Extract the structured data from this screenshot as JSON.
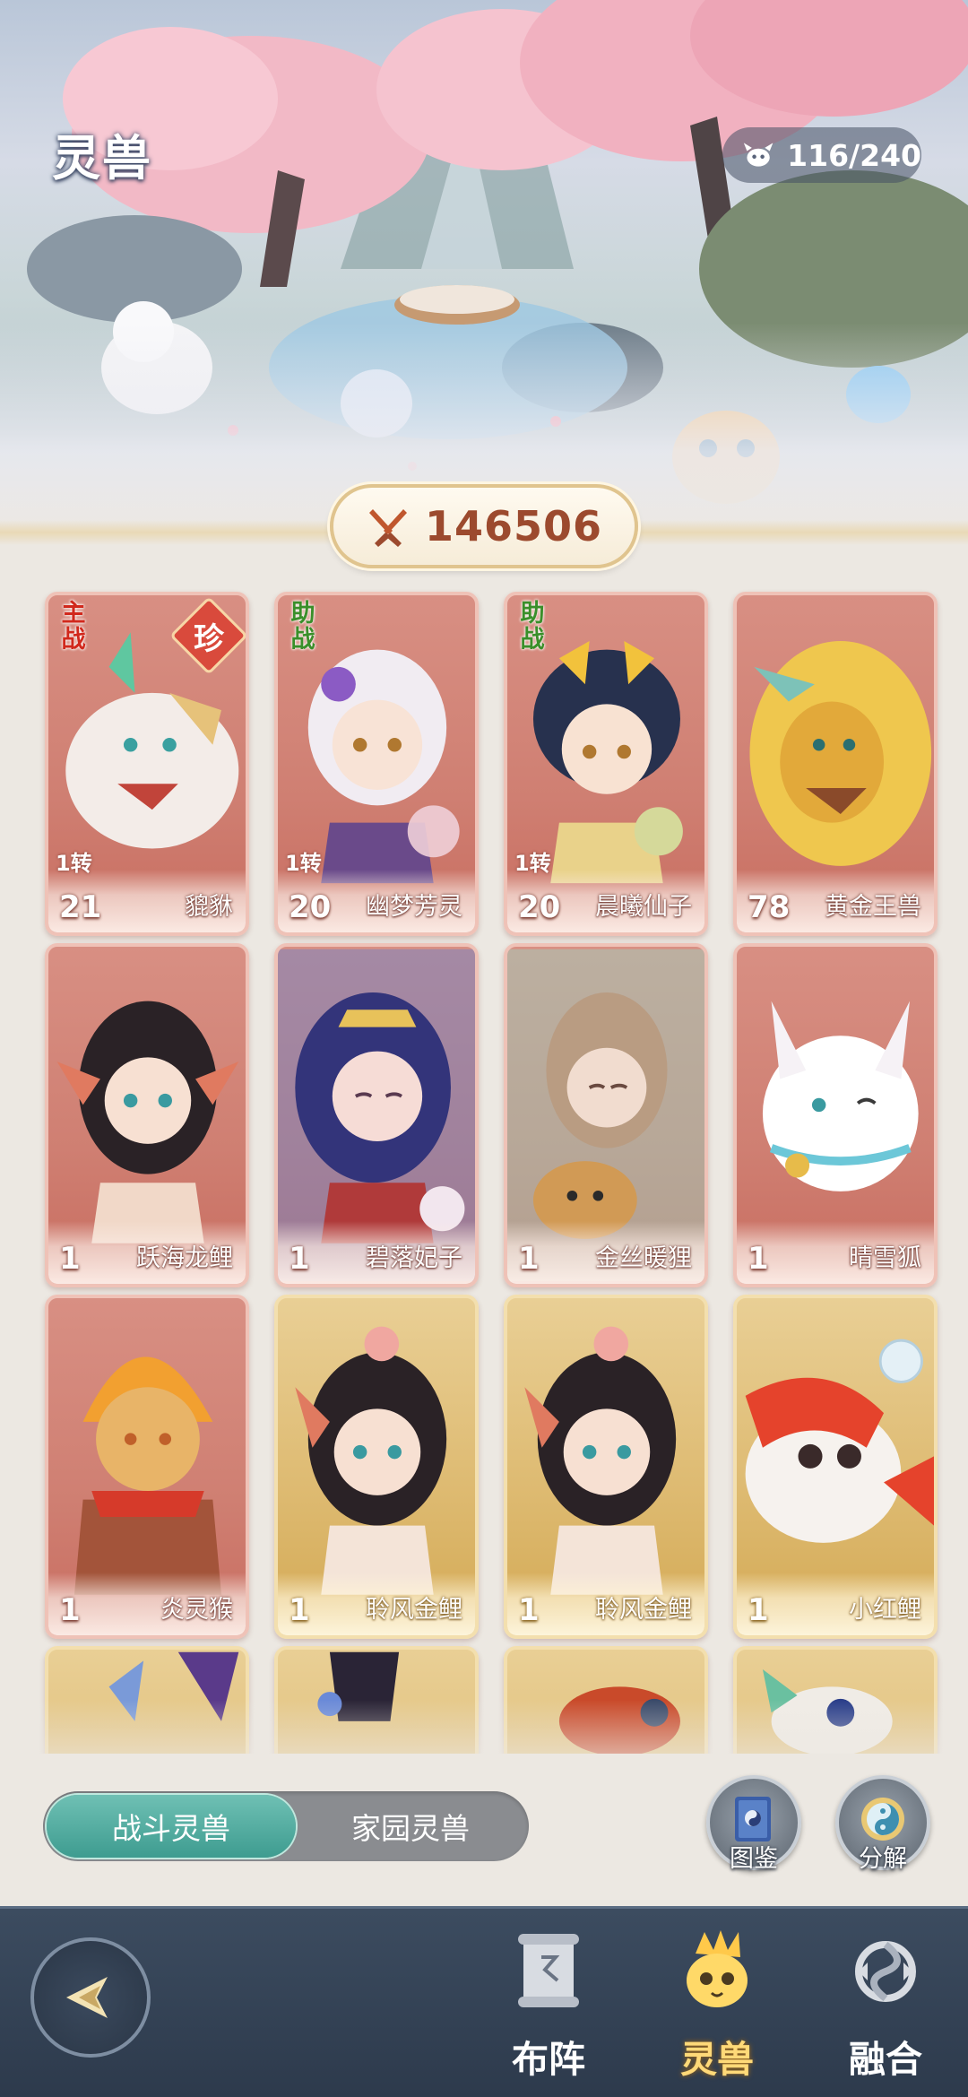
{
  "header": {
    "title": "灵兽",
    "capacity": "116/240"
  },
  "combat_power": "146506",
  "cards": [
    {
      "level": "21",
      "name": "貔貅",
      "turn": "1转",
      "role": "主战",
      "rare": "珍",
      "frame": "red"
    },
    {
      "level": "20",
      "name": "幽梦芳灵",
      "turn": "1转",
      "role": "助战",
      "rare": "",
      "frame": "red"
    },
    {
      "level": "20",
      "name": "晨曦仙子",
      "turn": "1转",
      "role": "助战",
      "rare": "",
      "frame": "red"
    },
    {
      "level": "78",
      "name": "黄金王兽",
      "turn": "",
      "role": "",
      "rare": "",
      "frame": "red"
    },
    {
      "level": "1",
      "name": "跃海龙鲤",
      "turn": "",
      "role": "",
      "rare": "",
      "frame": "red"
    },
    {
      "level": "1",
      "name": "碧落妃子",
      "turn": "",
      "role": "",
      "rare": "",
      "frame": "red"
    },
    {
      "level": "1",
      "name": "金丝暖狸",
      "turn": "",
      "role": "",
      "rare": "",
      "frame": "red"
    },
    {
      "level": "1",
      "name": "晴雪狐",
      "turn": "",
      "role": "",
      "rare": "",
      "frame": "red"
    },
    {
      "level": "1",
      "name": "炎灵猴",
      "turn": "",
      "role": "",
      "rare": "",
      "frame": "red"
    },
    {
      "level": "1",
      "name": "聆风金鲤",
      "turn": "",
      "role": "",
      "rare": "",
      "frame": "gold"
    },
    {
      "level": "1",
      "name": "聆风金鲤",
      "turn": "",
      "role": "",
      "rare": "",
      "frame": "gold"
    },
    {
      "level": "1",
      "name": "小红鲤",
      "turn": "",
      "role": "",
      "rare": "",
      "frame": "gold"
    }
  ],
  "tabs": {
    "combat": "战斗灵兽",
    "home": "家园灵兽",
    "active": "战斗灵兽"
  },
  "actions": {
    "atlas": "图鉴",
    "decompose": "分解"
  },
  "nav": {
    "formation": "布阵",
    "beasts": "灵兽",
    "fusion": "融合",
    "active": "灵兽"
  },
  "colors": {
    "card_red": "#d88f83",
    "card_gold": "#e3c27e",
    "tab_active": "#4fa99c",
    "nav_bg": "#34435a",
    "nav_active": "#ffd978",
    "power_text": "#9c4a2e",
    "role_main": "#d1281c",
    "role_help": "#3a8f2a"
  }
}
